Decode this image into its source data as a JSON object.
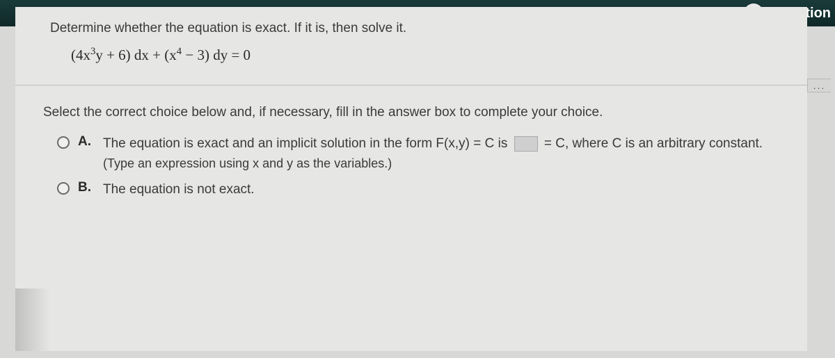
{
  "header": {
    "back_glyph": "<",
    "question_label": "Question"
  },
  "question": {
    "prompt": "Determine whether the equation is exact. If it is, then solve it.",
    "equation_html": "(4x<span class='sup'>3</span>y + 6) dx + (x<span class='sup'>4</span> − 3) dy = 0"
  },
  "select": {
    "prompt": "Select the correct choice below and, if necessary, fill in the answer box to complete your choice.",
    "ellipsis": "..."
  },
  "choices": {
    "a": {
      "letter": "A.",
      "text_before": "The equation is exact and an implicit solution in the form F(x,y) = C is ",
      "text_after": " = C, where C is an arbitrary constant.",
      "hint": "(Type an expression using x and y as the variables.)"
    },
    "b": {
      "letter": "B.",
      "text": "The equation is not exact."
    }
  }
}
